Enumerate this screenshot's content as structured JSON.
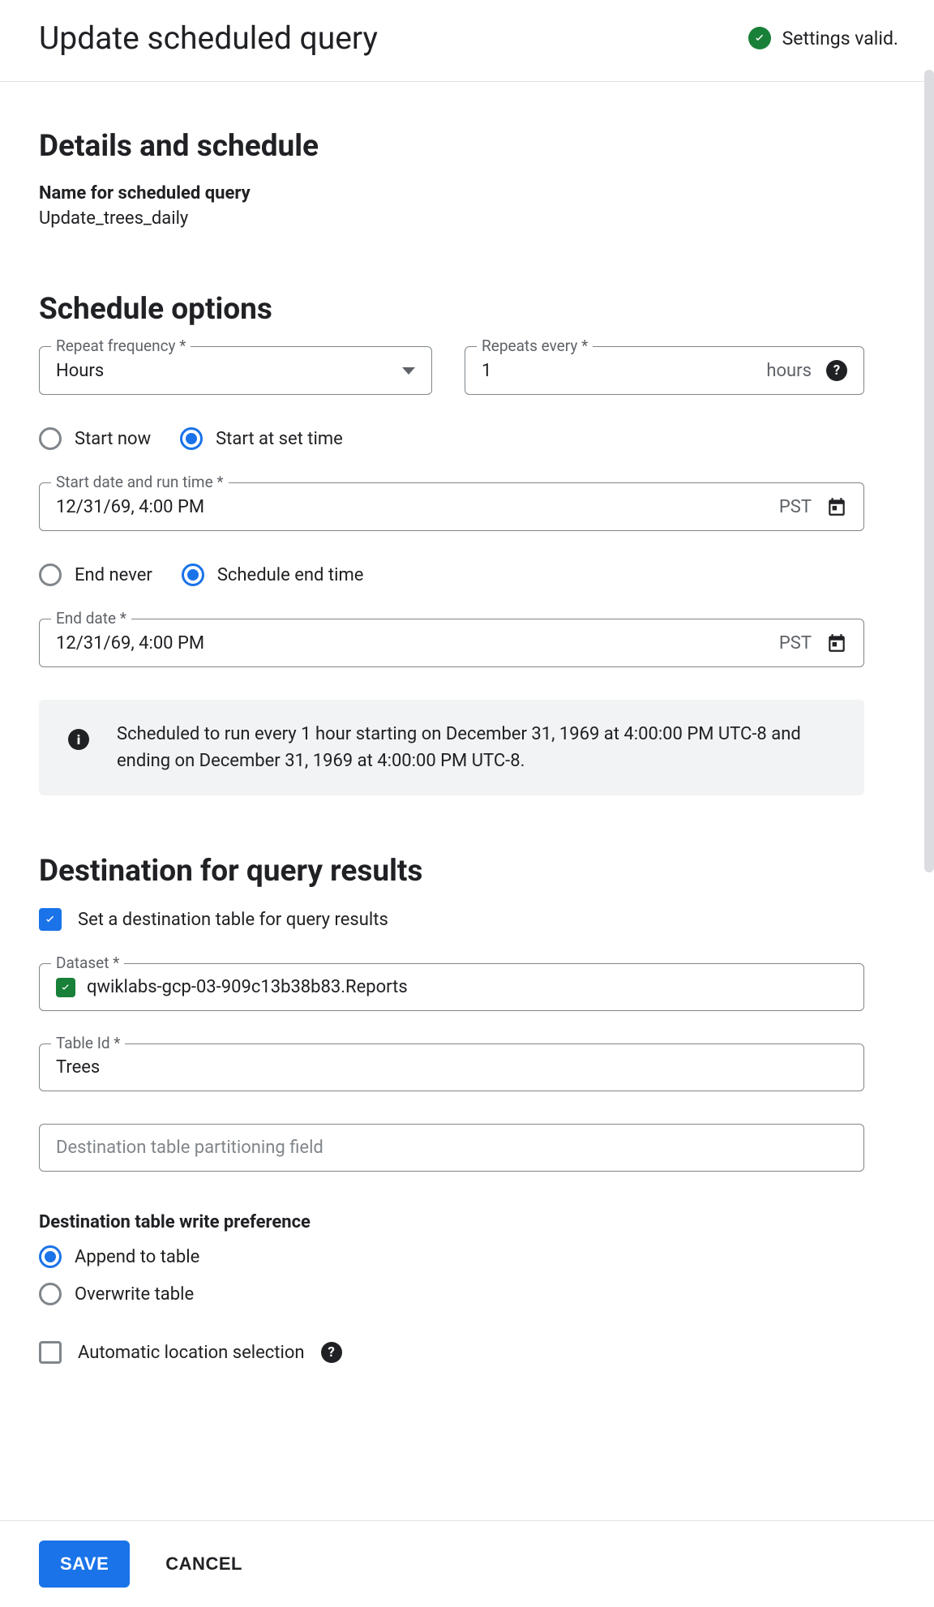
{
  "header": {
    "title": "Update scheduled query",
    "status_label": "Settings valid."
  },
  "details": {
    "heading": "Details and schedule",
    "name_label": "Name for scheduled query",
    "name_value": "Update_trees_daily"
  },
  "schedule": {
    "heading": "Schedule options",
    "repeat_frequency_label": "Repeat frequency *",
    "repeat_frequency_value": "Hours",
    "repeats_every_label": "Repeats every *",
    "repeats_every_value": "1",
    "repeats_every_unit": "hours",
    "start_now_label": "Start now",
    "start_set_time_label": "Start at set time",
    "start_selected": "start_set_time",
    "start_datetime_label": "Start date and run time *",
    "start_datetime_value": "12/31/69, 4:00 PM",
    "timezone": "PST",
    "end_never_label": "End never",
    "schedule_end_label": "Schedule end time",
    "end_selected": "schedule_end",
    "end_date_label": "End date *",
    "end_date_value": "12/31/69, 4:00 PM",
    "info_text": "Scheduled to run every 1 hour starting on December 31, 1969 at 4:00:00 PM UTC-8 and ending on December 31, 1969 at 4:00:00 PM UTC-8."
  },
  "destination": {
    "heading": "Destination for query results",
    "set_table_label": "Set a destination table for query results",
    "set_table_checked": true,
    "dataset_label": "Dataset *",
    "dataset_value": "qwiklabs-gcp-03-909c13b38b83.Reports",
    "table_id_label": "Table Id *",
    "table_id_value": "Trees",
    "partition_placeholder": "Destination table partitioning field",
    "write_pref_label": "Destination table write preference",
    "append_label": "Append to table",
    "overwrite_label": "Overwrite table",
    "write_pref_selected": "append",
    "auto_location_label": "Automatic location selection",
    "auto_location_checked": false
  },
  "footer": {
    "save_label": "SAVE",
    "cancel_label": "CANCEL"
  }
}
